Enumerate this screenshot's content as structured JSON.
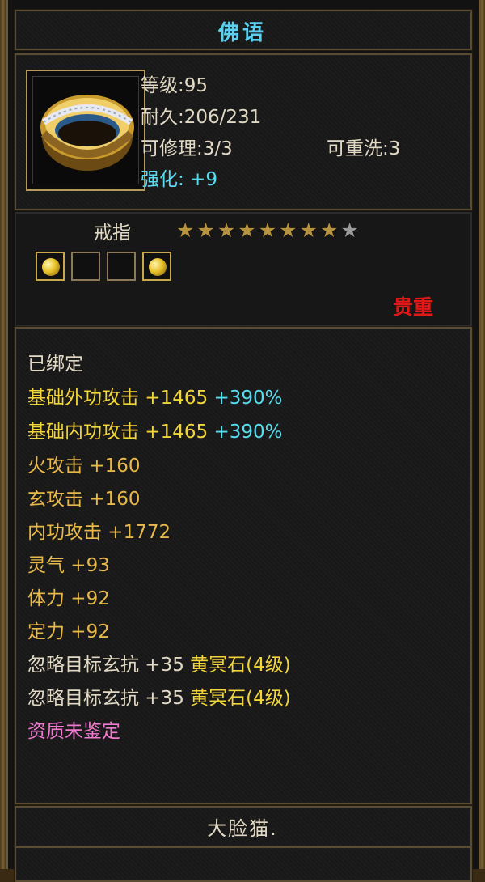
{
  "item": {
    "name": "佛语",
    "level": "等级:95",
    "durability": "耐久:206/231",
    "repair": "可修理:3/3",
    "rewash": "可重洗:3",
    "enhance": "强化: +9",
    "type": "戒指",
    "stars_total": 9,
    "stars_filled": 8,
    "sockets": [
      {
        "filled": true
      },
      {
        "filled": false
      },
      {
        "filled": false
      },
      {
        "filled": true
      }
    ],
    "rarity": "贵重"
  },
  "attributes": {
    "bound": "已绑定",
    "base_ext": {
      "label": "基础外功攻击 +1465",
      "bonus": "+390%"
    },
    "base_int": {
      "label": "基础内功攻击 +1465",
      "bonus": "+390%"
    },
    "fire": "火攻击 +160",
    "mystic": "玄攻击 +160",
    "inner": "内功攻击 +1772",
    "spirit": "灵气 +93",
    "stamina": "体力 +92",
    "focus": "定力 +92",
    "ignore1": {
      "label": "忽略目标玄抗 +35",
      "gem": "黄冥石(4级)"
    },
    "ignore2": {
      "label": "忽略目标玄抗 +35",
      "gem": "黄冥石(4级)"
    },
    "quality": "资质未鉴定"
  },
  "footer": {
    "owner": "大脸猫."
  },
  "colors": {
    "title": "#5ad0f0",
    "rarity": "#e01818",
    "attr_yellow": "#f2d53a",
    "attr_cyan": "#58dcf0",
    "attr_pink": "#f07ad0"
  }
}
